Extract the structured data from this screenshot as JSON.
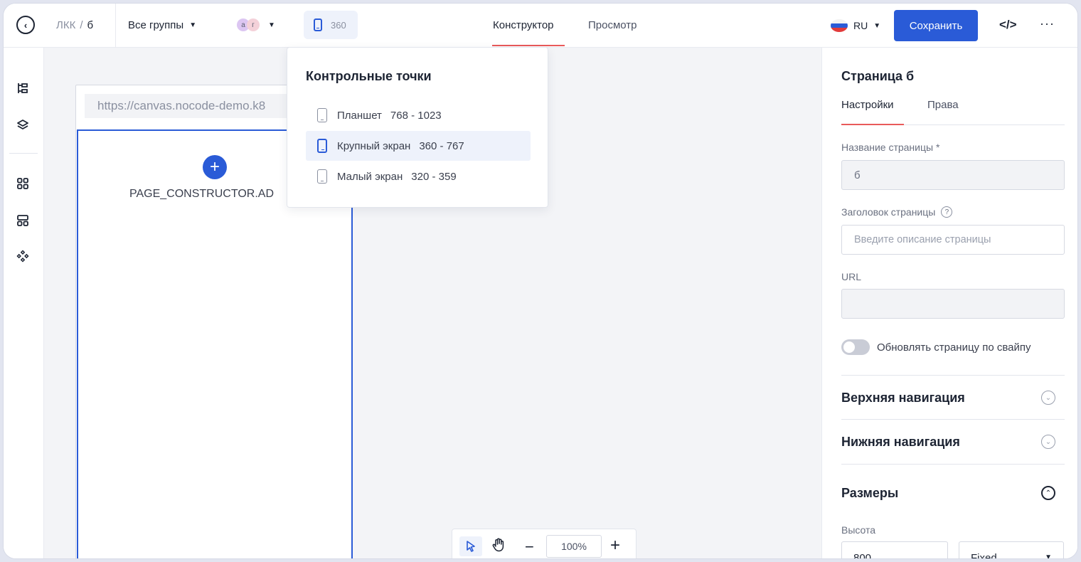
{
  "header": {
    "breadcrumb_root": "ЛКК",
    "breadcrumb_sep": "/",
    "breadcrumb_current": "б",
    "groups_label": "Все группы",
    "avatar_1": "а",
    "avatar_2": "г",
    "breakpoint_value": "360",
    "tab_constructor": "Конструктор",
    "tab_preview": "Просмотр",
    "language": "RU",
    "save_label": "Сохранить",
    "code_icon": "</>",
    "more_icon": "···"
  },
  "breakpoints": {
    "title": "Контрольные точки",
    "items": [
      {
        "name": "Планшет",
        "range": "768 - 1023"
      },
      {
        "name": "Крупный экран",
        "range": "360 - 767"
      },
      {
        "name": "Малый экран",
        "range": "320 - 359"
      }
    ],
    "selected_index": 1
  },
  "canvas": {
    "url": "https://canvas.nocode-demo.k8",
    "add_label": "PAGE_CONSTRUCTOR.AD",
    "zoom_value": "100%"
  },
  "panel": {
    "title": "Страница б",
    "tab_settings": "Настройки",
    "tab_rights": "Права",
    "page_name_label": "Название страницы *",
    "page_name_value": "б",
    "page_heading_label": "Заголовок страницы",
    "page_heading_placeholder": "Введите описание страницы",
    "url_label": "URL",
    "url_value": "",
    "swipe_refresh_label": "Обновлять страницу по свайпу",
    "swipe_refresh_on": false,
    "top_nav_title": "Верхняя навигация",
    "bottom_nav_title": "Нижняя навигация",
    "sizes_title": "Размеры",
    "height_label": "Высота",
    "height_value": "800",
    "height_mode": "Fixed"
  },
  "icons": {
    "back": "chevron-left-icon",
    "question": "?"
  },
  "colors": {
    "primary": "#2a5bd7",
    "accent_underline": "#e95a5a",
    "canvas_bg": "#f3f4f7"
  }
}
